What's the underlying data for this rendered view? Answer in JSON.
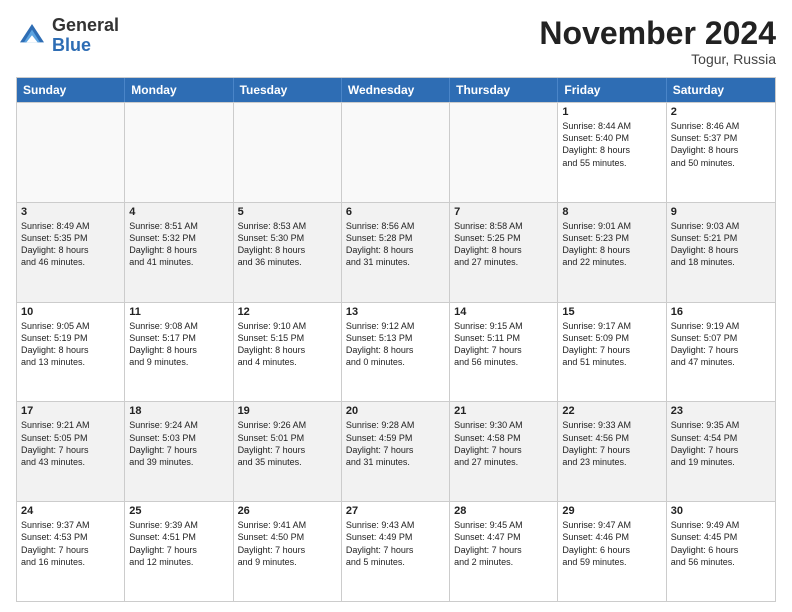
{
  "header": {
    "logo_general": "General",
    "logo_blue": "Blue",
    "month_title": "November 2024",
    "location": "Togur, Russia"
  },
  "days_of_week": [
    "Sunday",
    "Monday",
    "Tuesday",
    "Wednesday",
    "Thursday",
    "Friday",
    "Saturday"
  ],
  "weeks": [
    [
      {
        "day": "",
        "info": "",
        "empty": true
      },
      {
        "day": "",
        "info": "",
        "empty": true
      },
      {
        "day": "",
        "info": "",
        "empty": true
      },
      {
        "day": "",
        "info": "",
        "empty": true
      },
      {
        "day": "",
        "info": "",
        "empty": true
      },
      {
        "day": "1",
        "info": "Sunrise: 8:44 AM\nSunset: 5:40 PM\nDaylight: 8 hours\nand 55 minutes."
      },
      {
        "day": "2",
        "info": "Sunrise: 8:46 AM\nSunset: 5:37 PM\nDaylight: 8 hours\nand 50 minutes."
      }
    ],
    [
      {
        "day": "3",
        "info": "Sunrise: 8:49 AM\nSunset: 5:35 PM\nDaylight: 8 hours\nand 46 minutes."
      },
      {
        "day": "4",
        "info": "Sunrise: 8:51 AM\nSunset: 5:32 PM\nDaylight: 8 hours\nand 41 minutes."
      },
      {
        "day": "5",
        "info": "Sunrise: 8:53 AM\nSunset: 5:30 PM\nDaylight: 8 hours\nand 36 minutes."
      },
      {
        "day": "6",
        "info": "Sunrise: 8:56 AM\nSunset: 5:28 PM\nDaylight: 8 hours\nand 31 minutes."
      },
      {
        "day": "7",
        "info": "Sunrise: 8:58 AM\nSunset: 5:25 PM\nDaylight: 8 hours\nand 27 minutes."
      },
      {
        "day": "8",
        "info": "Sunrise: 9:01 AM\nSunset: 5:23 PM\nDaylight: 8 hours\nand 22 minutes."
      },
      {
        "day": "9",
        "info": "Sunrise: 9:03 AM\nSunset: 5:21 PM\nDaylight: 8 hours\nand 18 minutes."
      }
    ],
    [
      {
        "day": "10",
        "info": "Sunrise: 9:05 AM\nSunset: 5:19 PM\nDaylight: 8 hours\nand 13 minutes."
      },
      {
        "day": "11",
        "info": "Sunrise: 9:08 AM\nSunset: 5:17 PM\nDaylight: 8 hours\nand 9 minutes."
      },
      {
        "day": "12",
        "info": "Sunrise: 9:10 AM\nSunset: 5:15 PM\nDaylight: 8 hours\nand 4 minutes."
      },
      {
        "day": "13",
        "info": "Sunrise: 9:12 AM\nSunset: 5:13 PM\nDaylight: 8 hours\nand 0 minutes."
      },
      {
        "day": "14",
        "info": "Sunrise: 9:15 AM\nSunset: 5:11 PM\nDaylight: 7 hours\nand 56 minutes."
      },
      {
        "day": "15",
        "info": "Sunrise: 9:17 AM\nSunset: 5:09 PM\nDaylight: 7 hours\nand 51 minutes."
      },
      {
        "day": "16",
        "info": "Sunrise: 9:19 AM\nSunset: 5:07 PM\nDaylight: 7 hours\nand 47 minutes."
      }
    ],
    [
      {
        "day": "17",
        "info": "Sunrise: 9:21 AM\nSunset: 5:05 PM\nDaylight: 7 hours\nand 43 minutes."
      },
      {
        "day": "18",
        "info": "Sunrise: 9:24 AM\nSunset: 5:03 PM\nDaylight: 7 hours\nand 39 minutes."
      },
      {
        "day": "19",
        "info": "Sunrise: 9:26 AM\nSunset: 5:01 PM\nDaylight: 7 hours\nand 35 minutes."
      },
      {
        "day": "20",
        "info": "Sunrise: 9:28 AM\nSunset: 4:59 PM\nDaylight: 7 hours\nand 31 minutes."
      },
      {
        "day": "21",
        "info": "Sunrise: 9:30 AM\nSunset: 4:58 PM\nDaylight: 7 hours\nand 27 minutes."
      },
      {
        "day": "22",
        "info": "Sunrise: 9:33 AM\nSunset: 4:56 PM\nDaylight: 7 hours\nand 23 minutes."
      },
      {
        "day": "23",
        "info": "Sunrise: 9:35 AM\nSunset: 4:54 PM\nDaylight: 7 hours\nand 19 minutes."
      }
    ],
    [
      {
        "day": "24",
        "info": "Sunrise: 9:37 AM\nSunset: 4:53 PM\nDaylight: 7 hours\nand 16 minutes."
      },
      {
        "day": "25",
        "info": "Sunrise: 9:39 AM\nSunset: 4:51 PM\nDaylight: 7 hours\nand 12 minutes."
      },
      {
        "day": "26",
        "info": "Sunrise: 9:41 AM\nSunset: 4:50 PM\nDaylight: 7 hours\nand 9 minutes."
      },
      {
        "day": "27",
        "info": "Sunrise: 9:43 AM\nSunset: 4:49 PM\nDaylight: 7 hours\nand 5 minutes."
      },
      {
        "day": "28",
        "info": "Sunrise: 9:45 AM\nSunset: 4:47 PM\nDaylight: 7 hours\nand 2 minutes."
      },
      {
        "day": "29",
        "info": "Sunrise: 9:47 AM\nSunset: 4:46 PM\nDaylight: 6 hours\nand 59 minutes."
      },
      {
        "day": "30",
        "info": "Sunrise: 9:49 AM\nSunset: 4:45 PM\nDaylight: 6 hours\nand 56 minutes."
      }
    ]
  ]
}
